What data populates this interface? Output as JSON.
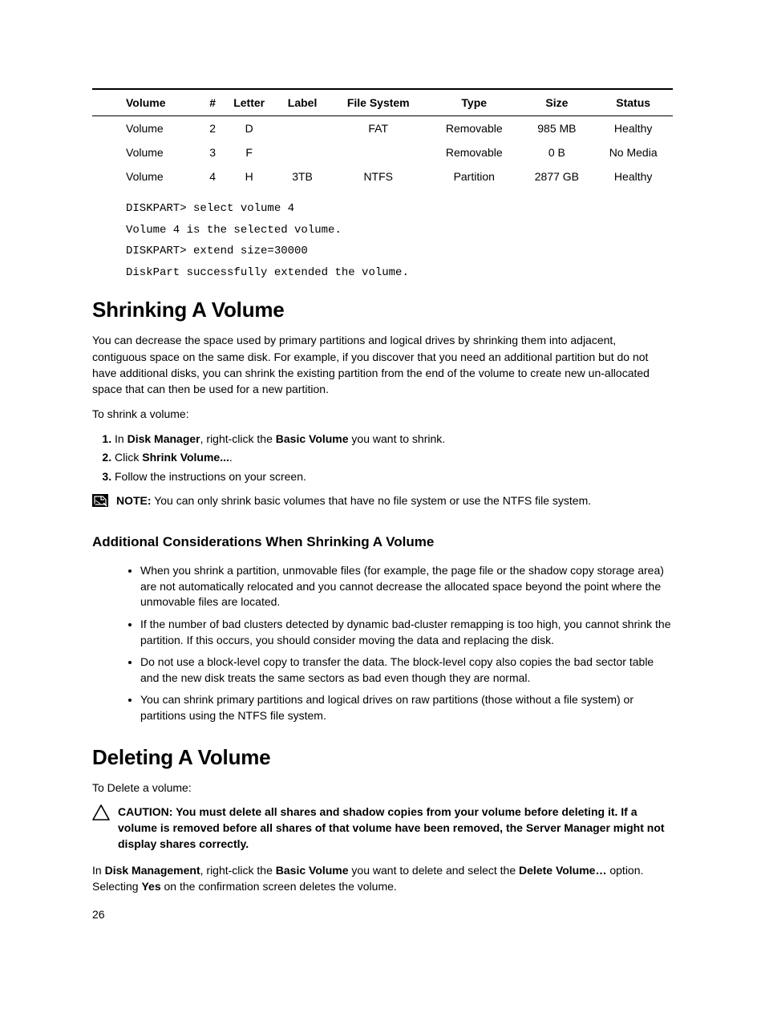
{
  "table": {
    "headers": [
      "Volume",
      "#",
      "Letter",
      "Label",
      "File System",
      "Type",
      "Size",
      "Status"
    ],
    "rows": [
      [
        "Volume",
        "2",
        "D",
        "",
        "FAT",
        "Removable",
        "985 MB",
        "Healthy"
      ],
      [
        "Volume",
        "3",
        "F",
        "",
        "",
        "Removable",
        "0 B",
        "No Media"
      ],
      [
        "Volume",
        "4",
        "H",
        "3TB",
        "NTFS",
        "Partition",
        "2877 GB",
        "Healthy"
      ]
    ]
  },
  "cmd": {
    "l1": "DISKPART> select volume 4",
    "l2": "Volume 4 is the selected volume.",
    "l3": "DISKPART> extend size=30000",
    "l4": "DiskPart successfully extended the volume."
  },
  "shrink": {
    "heading": "Shrinking A Volume",
    "intro": "You can decrease the space used by primary partitions and logical drives by shrinking them into adjacent, contiguous space on the same disk. For example, if you discover that you need an additional partition but do not have additional disks, you can shrink the existing partition from the end of the volume to create new un-allocated space that can then be used for a new partition.",
    "lead": "To shrink a volume:",
    "step1_a": "In ",
    "step1_b": "Disk Manager",
    "step1_c": ", right-click the ",
    "step1_d": "Basic Volume",
    "step1_e": " you want to shrink.",
    "step2_a": "Click ",
    "step2_b": "Shrink Volume...",
    "step2_c": ".",
    "step3": "Follow the instructions on your screen.",
    "note_label": "NOTE:",
    "note_text": " You can only shrink basic volumes that have no file system or use the NTFS file system.",
    "sub_heading": "Additional Considerations When Shrinking A Volume",
    "b1": "When you shrink a partition, unmovable files (for example, the page file or the shadow copy storage area) are not automatically relocated and you cannot decrease the allocated space beyond the point where the unmovable files are located.",
    "b2": "If the number of bad clusters detected by dynamic bad-cluster remapping is too high, you cannot shrink the partition. If this occurs, you should consider moving the data and replacing the disk.",
    "b3": "Do not use a block-level copy to transfer the data. The block-level copy also copies the bad sector table and the new disk treats the same sectors as bad even though they are normal.",
    "b4": "You can shrink primary partitions and logical drives on raw partitions (those without a file system) or partitions using the NTFS file system."
  },
  "delete": {
    "heading": "Deleting A Volume",
    "lead": "To Delete a volume:",
    "caution_label": "CAUTION: ",
    "caution_text": "You must delete all shares and shadow copies from your volume before deleting it. If a volume is removed before all shares of that volume have been removed, the Server Manager might not display shares correctly.",
    "p_a": "In ",
    "p_b": "Disk Management",
    "p_c": ", right-click the ",
    "p_d": "Basic Volume",
    "p_e": " you want to delete and select the ",
    "p_f": "Delete Volume…",
    "p_g": " option. Selecting ",
    "p_h": "Yes",
    "p_i": " on the confirmation screen deletes the volume."
  },
  "page_number": "26"
}
